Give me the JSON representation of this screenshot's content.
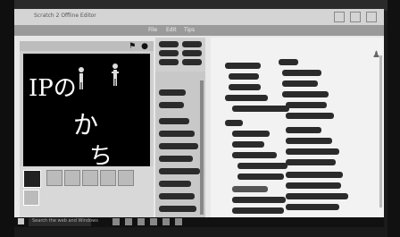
{
  "window": {
    "title": "Scratch 2 Offline Editor"
  },
  "menu": {
    "items": [
      "File",
      "Edit",
      "Tips"
    ]
  },
  "stage": {
    "text_main": "IPの",
    "text_kana1": "か",
    "text_kana2": "ち"
  },
  "palette": {
    "categories": [
      "Motion",
      "Looks",
      "Sound",
      "Pen",
      "Data",
      "Events",
      "Control",
      "Sensing",
      "Operators",
      "More"
    ]
  },
  "taskbar": {
    "search_placeholder": "Search the web and Windows"
  },
  "colors": {
    "stage_bg": "#000000",
    "block": "#2b2b2b",
    "script_bg": "#f2f2f2"
  }
}
